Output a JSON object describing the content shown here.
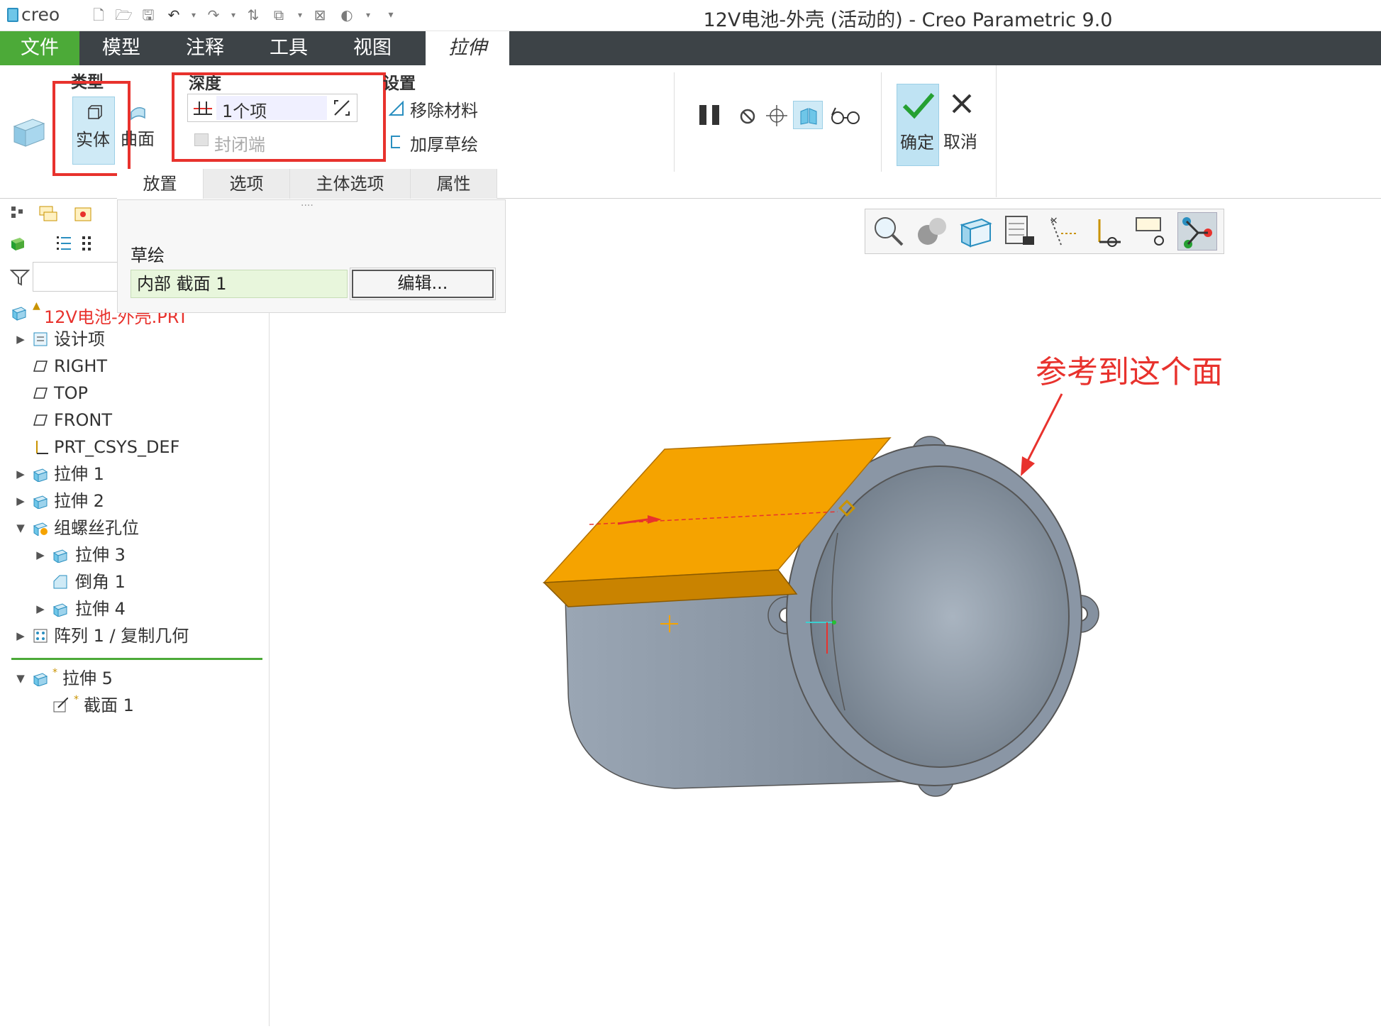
{
  "app": {
    "logo_text": "creo",
    "window_title": "12V电池-外壳 (活动的) - Creo Parametric 9.0"
  },
  "tabs": [
    {
      "label": "文件"
    },
    {
      "label": "模型"
    },
    {
      "label": "注释"
    },
    {
      "label": "工具"
    },
    {
      "label": "视图"
    },
    {
      "label": "拉伸"
    }
  ],
  "ribbon": {
    "type_group": {
      "label": "类型",
      "solid": "实体",
      "surface": "曲面"
    },
    "depth_group": {
      "label": "深度",
      "value": "1个项",
      "capped_ends": "封闭端"
    },
    "settings_group": {
      "label": "设置",
      "remove_material": "移除材料",
      "thicken_sketch": "加厚草绘"
    },
    "confirm": "确定",
    "cancel": "取消",
    "sub_tabs": [
      "放置",
      "选项",
      "主体选项",
      "属性"
    ]
  },
  "placement_panel": {
    "grip": "....",
    "sketch_label": "草绘",
    "sketch_value": "内部 截面 1",
    "edit_button": "编辑..."
  },
  "model_tree": {
    "root": "12V电池-外壳.PRT",
    "items": [
      {
        "label": "设计项",
        "icon": "design-items-icon"
      },
      {
        "label": "RIGHT",
        "icon": "datum-plane-icon"
      },
      {
        "label": "TOP",
        "icon": "datum-plane-icon"
      },
      {
        "label": "FRONT",
        "icon": "datum-plane-icon"
      },
      {
        "label": "PRT_CSYS_DEF",
        "icon": "csys-icon"
      },
      {
        "label": "拉伸 1",
        "icon": "extrude-icon"
      },
      {
        "label": "拉伸 2",
        "icon": "extrude-icon"
      },
      {
        "label": "组螺丝孔位",
        "icon": "group-icon"
      },
      {
        "label": "拉伸 3",
        "icon": "extrude-icon"
      },
      {
        "label": "倒角 1",
        "icon": "chamfer-icon"
      },
      {
        "label": "拉伸 4",
        "icon": "extrude-icon"
      },
      {
        "label": "阵列 1 / 复制几何",
        "icon": "pattern-icon"
      },
      {
        "label": "拉伸 5",
        "icon": "extrude-icon"
      },
      {
        "label": "截面 1",
        "icon": "sketch-icon"
      }
    ]
  },
  "annotation": "参考到这个面",
  "colors": {
    "file_tab": "#4caa38",
    "tab_bar": "#3d4347",
    "highlight_box": "#e8322d",
    "extrude_preview": "#f5a300",
    "model_body": "#8c98a6"
  }
}
